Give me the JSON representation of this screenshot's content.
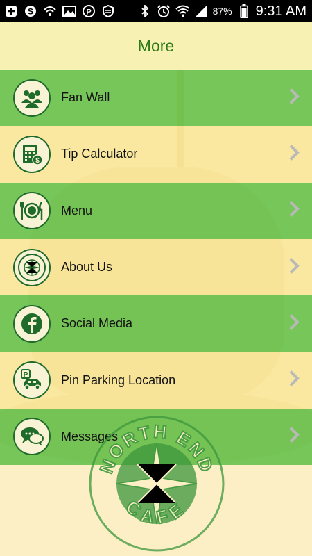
{
  "status_bar": {
    "battery_percent": "87%",
    "time": "9:31 AM",
    "icons": [
      "add-icon",
      "skype-icon",
      "wifi-question-icon",
      "image-icon",
      "pinterest-icon",
      "shield-icon",
      "bluetooth-icon",
      "alarm-icon",
      "wifi-icon",
      "signal-icon",
      "battery-icon"
    ]
  },
  "header": {
    "title": "More"
  },
  "menu": {
    "items": [
      {
        "label": "Fan Wall",
        "icon": "people-icon"
      },
      {
        "label": "Tip Calculator",
        "icon": "calculator-icon"
      },
      {
        "label": "Menu",
        "icon": "plate-utensils-icon"
      },
      {
        "label": "About Us",
        "icon": "north-end-compass-icon"
      },
      {
        "label": "Social Media",
        "icon": "facebook-icon"
      },
      {
        "label": "Pin Parking Location",
        "icon": "parking-car-icon"
      },
      {
        "label": "Messages",
        "icon": "chat-bubbles-icon"
      }
    ]
  },
  "logo": {
    "top_text": "NORTH END",
    "bottom_text": "CAFE"
  },
  "colors": {
    "accent_green": "#2c7a16",
    "row_green": "#5fbe46",
    "row_yellow": "#f8e696",
    "icon_border": "#1f6b2c"
  }
}
